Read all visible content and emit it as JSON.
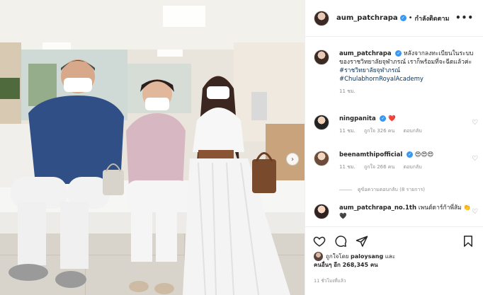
{
  "header": {
    "username": "aum_patchrapa",
    "follow_status": "กำลังติดตาม",
    "separator": "•",
    "more": "•••"
  },
  "caption": {
    "username": "aum_patchrapa",
    "text": "หลังจากลงทะเบียนในระบบของราชวิทยาลัยจุฬาภรณ์ เราก็พร้อมที่จะฉีดแล้วค่ะ",
    "hashtags": "#ราชวิทยาลัยจุฬาภรณ์ #ChulabhornRoyalAcademy",
    "time": "11 ชม."
  },
  "comments": [
    {
      "username": "ningpanita",
      "text": "❤️",
      "time": "11 ชม.",
      "likes": "ถูกใจ 326 คน",
      "reply": "ตอบกลับ"
    },
    {
      "username": "beenamthipofficial",
      "text": "😍😍😍",
      "time": "11 ชม.",
      "likes": "ถูกใจ 266 คน",
      "reply": "ตอบกลับ"
    },
    {
      "username": "aum_patchrapa_no.1th",
      "text": "เพนต์ดาร์ก้าพี่ส้ม 👏🖤",
      "time": "",
      "likes": "",
      "reply": ""
    }
  ],
  "view_replies": "ดูข้อความตอบกลับ (8 รายการ)",
  "likes": {
    "prefix": "ถูกใจโดย",
    "user": "paloysang",
    "and": "และ",
    "others": "คนอื่นๆ อีก 268,345 คน"
  },
  "timestamp": "11 ชั่วโมงที่แล้ว",
  "colors": {
    "verified": "#3897f0",
    "hashtag": "#00376b",
    "muted": "#8e8e8e"
  },
  "icons": {
    "like": "heart-icon",
    "comment": "comment-icon",
    "share": "paper-plane-icon",
    "save": "bookmark-icon"
  }
}
